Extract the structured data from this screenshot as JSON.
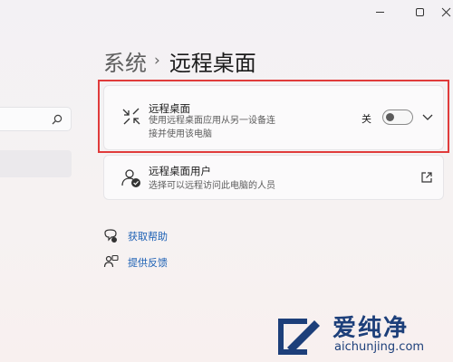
{
  "breadcrumb": {
    "parent": "系统",
    "separator": "›",
    "current": "远程桌面"
  },
  "search": {
    "value": "",
    "placeholder": ""
  },
  "remote_desktop": {
    "title": "远程桌面",
    "description_line1": "使用远程桌面应用从另一设备连",
    "description_line2": "接并使用该电脑",
    "toggle_state_label": "关",
    "toggle_on": false
  },
  "remote_desktop_users": {
    "title": "远程桌面用户",
    "description": "选择可以远程访问此电脑的人员"
  },
  "links": {
    "help": "获取帮助",
    "feedback": "提供反馈"
  },
  "window_controls": {
    "minimize": "—",
    "maximize": "☐",
    "close": "✕"
  },
  "watermark": {
    "brand": "爱纯净",
    "url": "aichunjing.com"
  },
  "colors": {
    "highlight_frame": "#e03b3b",
    "link": "#1a5fb4",
    "watermark": "#1d3f7a"
  }
}
